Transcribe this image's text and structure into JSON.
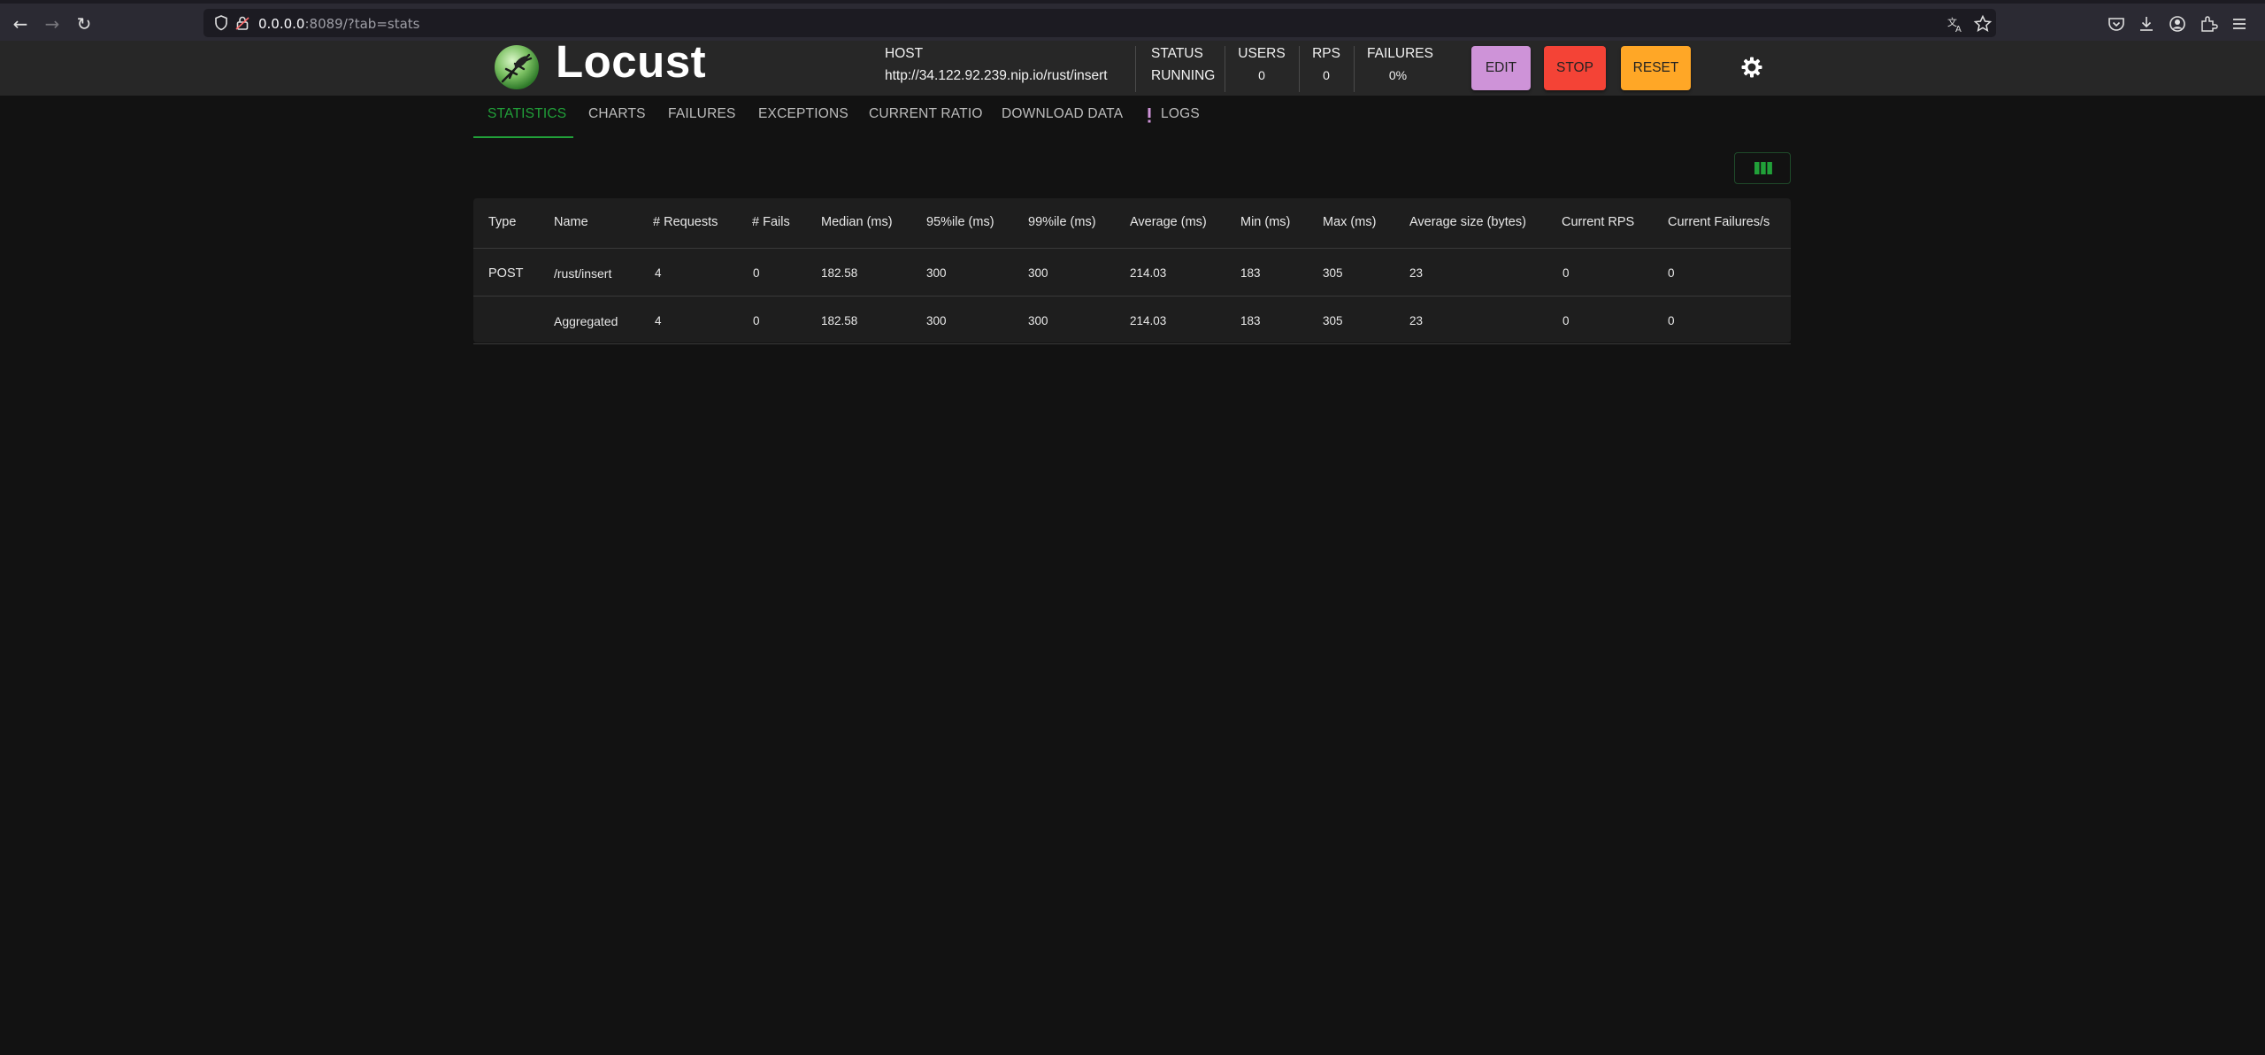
{
  "browser": {
    "url_host": "0.0.0.0",
    "url_rest": ":8089/?tab=stats"
  },
  "header": {
    "app_name": "Locust",
    "host_label": "HOST",
    "host_value": "http://34.122.92.239.nip.io/rust/insert",
    "status_label": "STATUS",
    "status_value": "RUNNING",
    "users_label": "USERS",
    "users_value": "0",
    "rps_label": "RPS",
    "rps_value": "0",
    "failures_label": "FAILURES",
    "failures_value": "0%",
    "edit_label": "EDIT",
    "stop_label": "STOP",
    "reset_label": "RESET",
    "colors": {
      "edit": "#ce93d8",
      "stop": "#f44336",
      "reset": "#ffa726"
    }
  },
  "tabs": [
    {
      "label": "STATISTICS"
    },
    {
      "label": "CHARTS"
    },
    {
      "label": "FAILURES"
    },
    {
      "label": "EXCEPTIONS"
    },
    {
      "label": "CURRENT RATIO"
    },
    {
      "label": "DOWNLOAD DATA"
    },
    {
      "label": "LOGS"
    }
  ],
  "accent_color": "#21a039",
  "table": {
    "columns": [
      "Type",
      "Name",
      "# Requests",
      "# Fails",
      "Median (ms)",
      "95%ile (ms)",
      "99%ile (ms)",
      "Average (ms)",
      "Min (ms)",
      "Max (ms)",
      "Average size (bytes)",
      "Current RPS",
      "Current Failures/s"
    ],
    "rows": [
      [
        "POST",
        "/rust/insert",
        "4",
        "0",
        "182.58",
        "300",
        "300",
        "214.03",
        "183",
        "305",
        "23",
        "0",
        "0"
      ],
      [
        "",
        "Aggregated",
        "4",
        "0",
        "182.58",
        "300",
        "300",
        "214.03",
        "183",
        "305",
        "23",
        "0",
        "0"
      ]
    ]
  }
}
